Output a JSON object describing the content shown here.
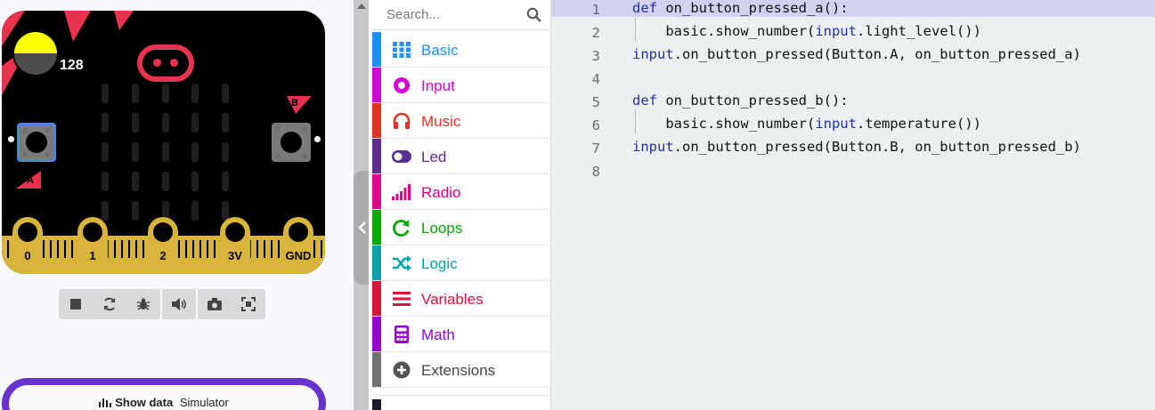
{
  "simulator": {
    "light_level": "128",
    "button_a_label": "A",
    "button_b_label": "B",
    "pins": [
      "0",
      "1",
      "2",
      "3V",
      "GND"
    ],
    "toolbar": [
      {
        "name": "stop",
        "icon": "stop-icon"
      },
      {
        "name": "restart",
        "icon": "refresh-icon"
      },
      {
        "name": "debug",
        "icon": "bug-icon"
      },
      {
        "name": "mute",
        "icon": "volume-icon"
      },
      {
        "name": "screenshot",
        "icon": "camera-icon"
      },
      {
        "name": "fullscreen",
        "icon": "expand-icon"
      }
    ],
    "show_data": {
      "bold": "Show data",
      "rest": "Simulator"
    }
  },
  "toolbox": {
    "search_placeholder": "Search...",
    "categories": [
      {
        "label": "Basic",
        "color": "#1e90ff",
        "icon": "grid-icon"
      },
      {
        "label": "Input",
        "color": "#d400d4",
        "icon": "target-icon"
      },
      {
        "label": "Music",
        "color": "#e63022",
        "icon": "headphones-icon"
      },
      {
        "label": "Led",
        "color": "#5c2d91",
        "icon": "toggle-icon"
      },
      {
        "label": "Radio",
        "color": "#e3008c",
        "icon": "signal-icon"
      },
      {
        "label": "Loops",
        "color": "#00aa00",
        "icon": "loop-icon"
      },
      {
        "label": "Logic",
        "color": "#00a4a6",
        "icon": "shuffle-icon"
      },
      {
        "label": "Variables",
        "color": "#dc143c",
        "icon": "list-icon"
      },
      {
        "label": "Math",
        "color": "#9400d3",
        "icon": "calculator-icon"
      },
      {
        "label": "Extensions",
        "color": "#717171",
        "icon": "plus-circle-icon"
      }
    ]
  },
  "editor": {
    "lines": [
      {
        "num": "1",
        "text": "def on_button_pressed_a():"
      },
      {
        "num": "2",
        "text": "    basic.show_number(input.light_level())"
      },
      {
        "num": "3",
        "text": "input.on_button_pressed(Button.A, on_button_pressed_a)"
      },
      {
        "num": "4",
        "text": ""
      },
      {
        "num": "5",
        "text": "def on_button_pressed_b():"
      },
      {
        "num": "6",
        "text": "    basic.show_number(input.temperature())"
      },
      {
        "num": "7",
        "text": "input.on_button_pressed(Button.B, on_button_pressed_b)"
      },
      {
        "num": "8",
        "text": ""
      }
    ]
  }
}
